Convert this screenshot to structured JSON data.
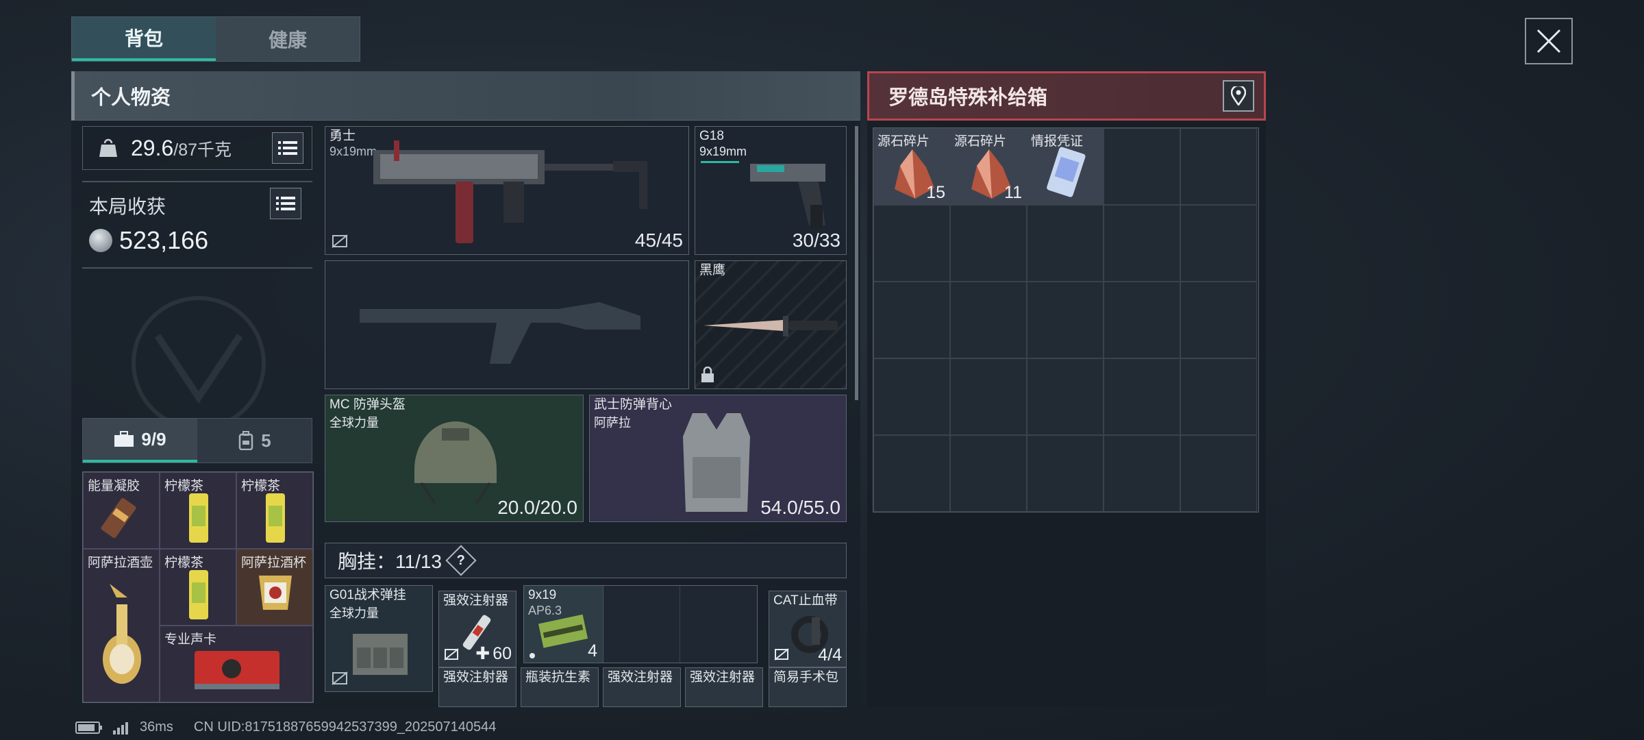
{
  "tabs": [
    {
      "label": "背包"
    },
    {
      "label": "健康"
    }
  ],
  "left_panel": {
    "title": "个人物资",
    "weight_current": "29.6",
    "weight_max": "/87千克",
    "haul_title": "本局收获",
    "haul_value": "523,166",
    "inv_tab_case": "9/9",
    "inv_tab_backpack": "5",
    "inventory": [
      "能量凝胶",
      "柠檬茶",
      "柠檬茶",
      "阿萨拉酒壶",
      "柠檬茶",
      "阿萨拉酒杯",
      "专业声卡"
    ]
  },
  "slots": {
    "primary": {
      "name": "勇士",
      "caliber": "9x19mm",
      "ammo": "45/45"
    },
    "sidearm": {
      "name": "G18",
      "caliber": "9x19mm",
      "ammo": "30/33"
    },
    "melee": {
      "name": "黑鹰"
    },
    "helmet": {
      "name": "MC 防弹头盔",
      "brand": "全球力量",
      "durability": "20.0/20.0"
    },
    "armor": {
      "name": "武士防弹背心",
      "brand": "阿萨拉",
      "durability": "54.0/55.0"
    }
  },
  "chest_rig": {
    "label": "胸挂：11/13",
    "help": "?",
    "rig_name": "G01战术弹挂",
    "rig_brand": "全球力量",
    "injector": {
      "label": "强效注射器",
      "count": "60"
    },
    "ammo": {
      "label": "9x19",
      "sub": "AP6.3",
      "count": "4"
    },
    "tourniquet": {
      "label": "CAT止血带",
      "count": "4/4"
    },
    "bottom_row": [
      "强效注射器",
      "瓶装抗生素",
      "强效注射器",
      "强效注射器",
      "简易手术包"
    ]
  },
  "right_panel": {
    "title": "罗德岛特殊补给箱",
    "items": [
      {
        "label": "源石碎片",
        "count": "15"
      },
      {
        "label": "源石碎片",
        "count": "11"
      },
      {
        "label": "情报凭证",
        "count": ""
      }
    ]
  },
  "status": {
    "ping": "36ms",
    "uid": "CN UID:817518876599425373​99_202507140544"
  },
  "colors": {
    "accent": "#2fb9a0",
    "loot_header": "#b8454f"
  }
}
